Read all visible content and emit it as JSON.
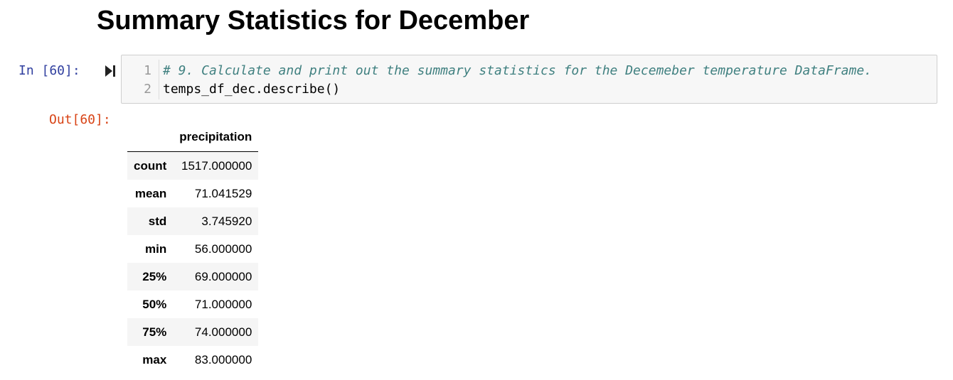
{
  "heading": "Summary Statistics for December",
  "input_cell": {
    "prompt": "In [60]:",
    "run_icon": "run-cell-icon",
    "line_numbers": [
      "1",
      "2"
    ],
    "code": {
      "comment": "# 9. Calculate and print out the summary statistics for the Decemeber temperature DataFrame.",
      "statement": "temps_df_dec.describe()"
    }
  },
  "output_cell": {
    "prompt": "Out[60]:",
    "table": {
      "corner": "",
      "column_header": "precipitation",
      "rows": [
        {
          "label": "count",
          "value": "1517.000000"
        },
        {
          "label": "mean",
          "value": "71.041529"
        },
        {
          "label": "std",
          "value": "3.745920"
        },
        {
          "label": "min",
          "value": "56.000000"
        },
        {
          "label": "25%",
          "value": "69.000000"
        },
        {
          "label": "50%",
          "value": "71.000000"
        },
        {
          "label": "75%",
          "value": "74.000000"
        },
        {
          "label": "max",
          "value": "83.000000"
        }
      ]
    }
  },
  "colors": {
    "in_prompt": "#303F9F",
    "out_prompt": "#D84315",
    "comment": "#408080",
    "cell_background": "#f7f7f7",
    "striped_row": "#f5f5f5"
  }
}
